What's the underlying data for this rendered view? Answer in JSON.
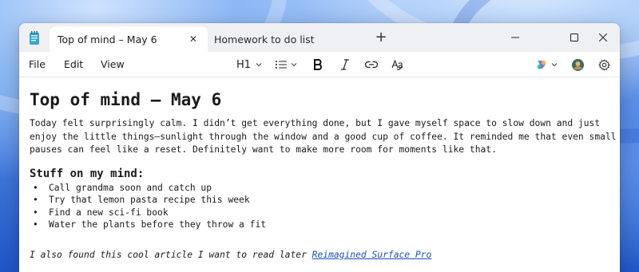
{
  "window": {
    "tabs": [
      {
        "label": "Top of mind – May 6",
        "active": true
      },
      {
        "label": "Homework to do list",
        "active": false
      }
    ],
    "close_tab_glyph": "✕",
    "new_tab_glyph": "+",
    "controls": {
      "minimize_icon": "minimize-icon",
      "maximize_icon": "maximize-icon",
      "close_icon": "close-icon"
    }
  },
  "menu": {
    "file": "File",
    "edit": "Edit",
    "view": "View"
  },
  "toolbar": {
    "heading_label": "H1",
    "icons": [
      "list-icon",
      "bold-icon",
      "italic-icon",
      "link-icon",
      "spellcheck-icon",
      "copilot-icon",
      "avatar",
      "settings-icon"
    ]
  },
  "document": {
    "title": "Top of mind – May 6",
    "paragraph": "Today felt surprisingly calm. I didn’t get everything done, but I gave myself space to slow down and just enjoy the little things—sunlight through the window and a good cup of coffee. It reminded me that even small pauses can feel like a reset. Definitely want to make more room for moments like that.",
    "section_heading": "Stuff on my mind:",
    "bullet_glyph": "•",
    "bullets": [
      "Call grandma soon and catch up",
      "Try that lemon pasta recipe this week",
      "Find a new sci-fi book",
      "Water the plants before they throw a fit"
    ],
    "article_text": "I also found this cool article I want to read later ",
    "article_link": "Reimagined Surface Pro"
  },
  "colors": {
    "link": "#1a4fb8",
    "titlebar": "#eef0f3",
    "copilot_accent": "#7a5cff"
  }
}
